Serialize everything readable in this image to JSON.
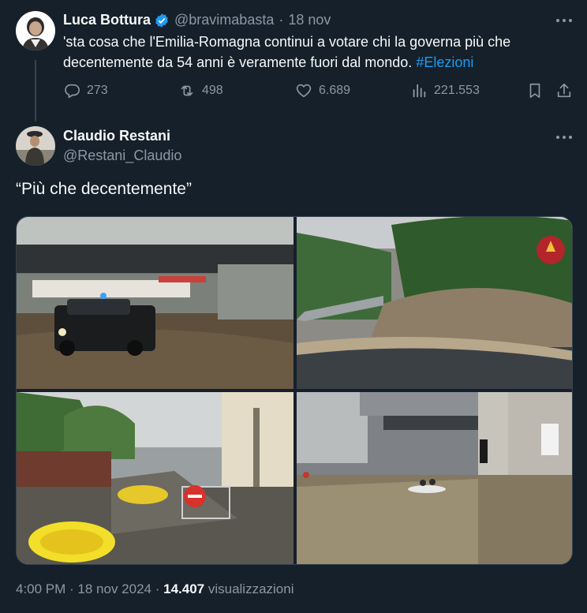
{
  "tweet": {
    "display_name": "Luca Bottura",
    "handle": "@bravimabasta",
    "separator": "·",
    "date": "18 nov",
    "text": "'sta cosa che l'Emilia-Romagna continui a votare chi la governa più che decentemente da 54 anni è veramente fuori dal mondo.",
    "hashtag": "#Elezioni",
    "replies": "273",
    "retweets": "498",
    "likes": "6.689",
    "views": "221.553",
    "more_icon": "more-icon",
    "verified_color": "#1d9bf0"
  },
  "reply": {
    "display_name": "Claudio Restani",
    "handle": "@Restani_Claudio",
    "text": "“Più che decentemente”",
    "media_caption_stamp": "",
    "timestamp": "4:00 PM · 18 nov 2024 · ",
    "views_count": "14.407",
    "views_label": " visualizzazioni"
  },
  "colors": {
    "background": "#15202b",
    "text": "#f7f9f9",
    "secondary": "#8b98a5",
    "accent": "#1d9bf0",
    "border": "#38444d"
  }
}
